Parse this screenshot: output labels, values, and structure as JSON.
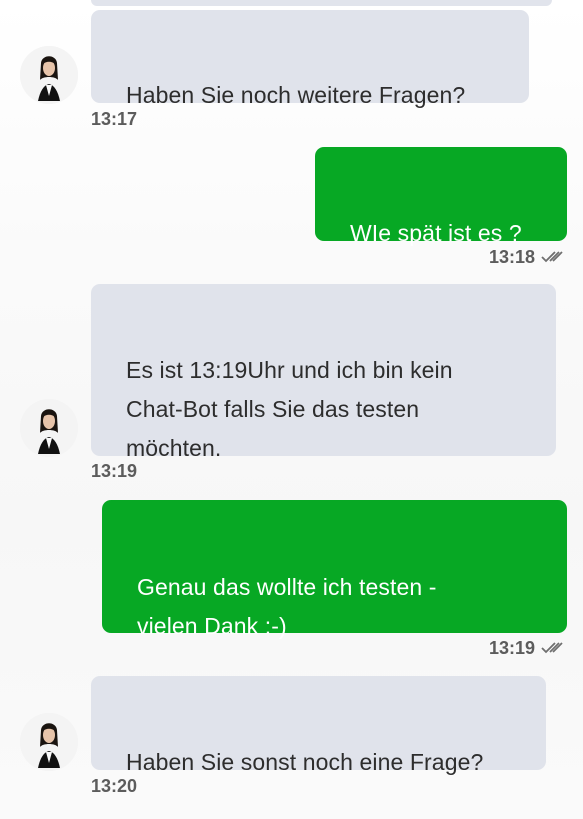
{
  "messages": [
    {
      "direction": "in",
      "text": "Haben Sie noch weitere Fragen?",
      "time": "13:17",
      "avatar_icon": "agent-avatar-icon"
    },
    {
      "direction": "out",
      "text": "WIe spät ist es ?",
      "time": "13:18",
      "status_icon": "double-check-icon"
    },
    {
      "direction": "in",
      "text": "Es ist 13:19Uhr und ich bin kein\nChat-Bot falls Sie das testen\nmöchten.",
      "time": "13:19",
      "avatar_icon": "agent-avatar-icon"
    },
    {
      "direction": "out",
      "text": "Genau das wollte ich testen -\nvielen Dank :-)",
      "time": "13:19",
      "status_icon": "double-check-icon"
    },
    {
      "direction": "in",
      "text": "Haben Sie sonst noch eine Frage?",
      "time": "13:20",
      "avatar_icon": "agent-avatar-icon"
    }
  ],
  "colors": {
    "incoming_bubble": "#e0e3eb",
    "outgoing_bubble": "#07a824",
    "outgoing_text": "#ffffff",
    "timestamp": "#5c5c5c"
  }
}
